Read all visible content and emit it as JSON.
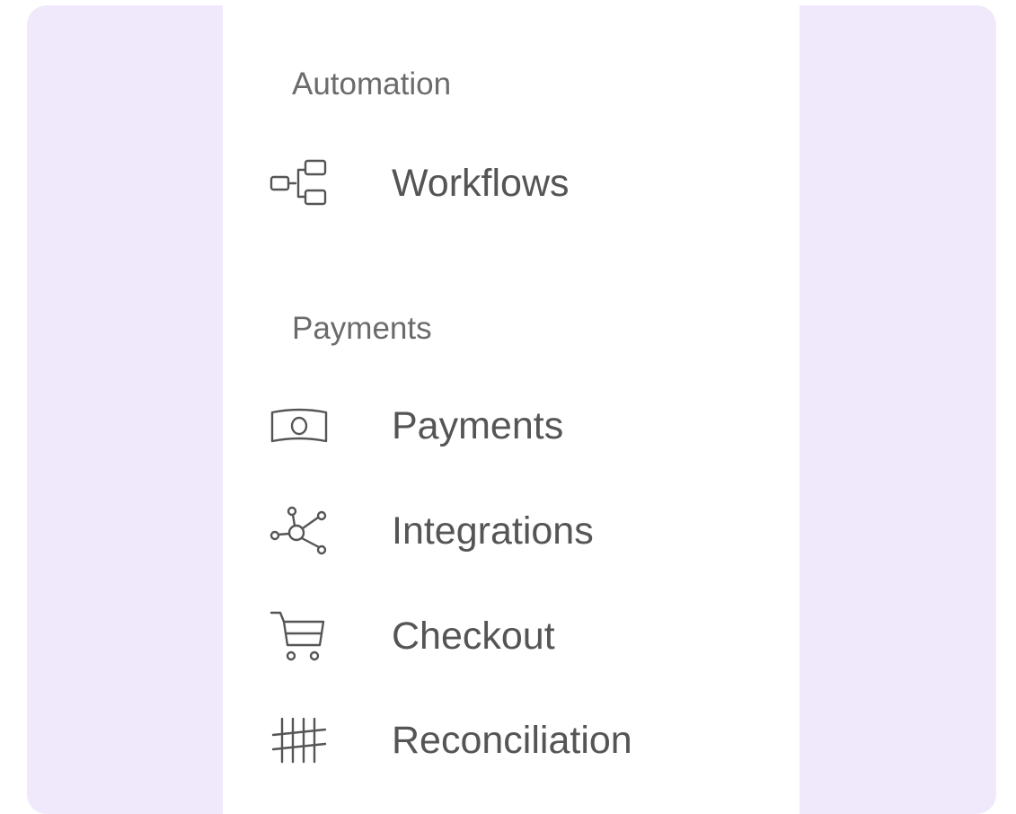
{
  "sections": [
    {
      "title": "Automation",
      "items": [
        {
          "label": "Workflows",
          "icon": "workflow-icon"
        }
      ]
    },
    {
      "title": "Payments",
      "items": [
        {
          "label": "Payments",
          "icon": "banknote-icon"
        },
        {
          "label": "Integrations",
          "icon": "network-nodes-icon"
        },
        {
          "label": "Checkout",
          "icon": "shopping-cart-icon"
        },
        {
          "label": "Reconciliation",
          "icon": "tally-marks-icon"
        }
      ]
    }
  ],
  "colors": {
    "background": "#f0e8fb",
    "panel": "#ffffff",
    "section_title": "#6b6b6b",
    "item_text": "#555555",
    "icon_stroke": "#555555"
  }
}
